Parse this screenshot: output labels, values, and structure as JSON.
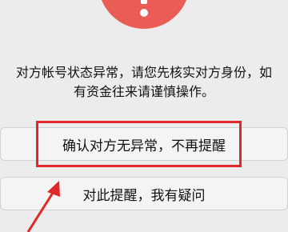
{
  "dialog": {
    "icon": "exclamation-icon",
    "message_line1": "对方帐号状态异常，请您先核实对方身份，如",
    "message_line2": "有资金往来请谨慎操作。"
  },
  "buttons": {
    "confirm_label": "确认对方无异常，不再提醒",
    "question_label": "对此提醒，我有疑问"
  },
  "annotation": {
    "color": "#e0282b"
  },
  "colors": {
    "warning": "#ea5c56",
    "background": "#ececec"
  }
}
